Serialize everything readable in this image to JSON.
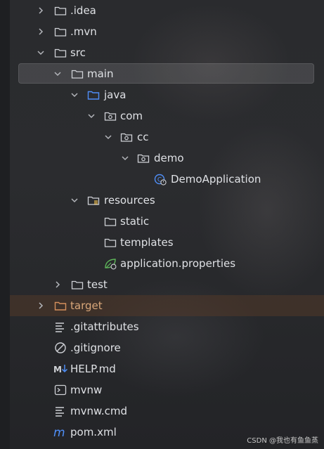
{
  "tree": {
    "items": [
      {
        "label": ".idea",
        "icon": "folder-icon"
      },
      {
        "label": ".mvn",
        "icon": "folder-icon"
      },
      {
        "label": "src",
        "icon": "folder-icon"
      },
      {
        "label": "main",
        "icon": "folder-icon"
      },
      {
        "label": "java",
        "icon": "source-folder-icon"
      },
      {
        "label": "com",
        "icon": "package-icon"
      },
      {
        "label": "cc",
        "icon": "package-icon"
      },
      {
        "label": "demo",
        "icon": "package-icon"
      },
      {
        "label": "DemoApplication",
        "icon": "spring-boot-class-icon"
      },
      {
        "label": "resources",
        "icon": "resources-folder-icon"
      },
      {
        "label": "static",
        "icon": "folder-icon"
      },
      {
        "label": "templates",
        "icon": "folder-icon"
      },
      {
        "label": "application.properties",
        "icon": "spring-properties-icon"
      },
      {
        "label": "test",
        "icon": "folder-icon"
      },
      {
        "label": "target",
        "icon": "excluded-folder-icon"
      },
      {
        "label": ".gitattributes",
        "icon": "text-file-icon"
      },
      {
        "label": ".gitignore",
        "icon": "ignore-file-icon"
      },
      {
        "label": "HELP.md",
        "icon": "markdown-icon"
      },
      {
        "label": "mvnw",
        "icon": "shell-script-icon"
      },
      {
        "label": "mvnw.cmd",
        "icon": "text-file-icon"
      },
      {
        "label": "pom.xml",
        "icon": "maven-icon"
      }
    ]
  },
  "watermark": "CSDN @我也有鱼鱼蒸",
  "colors": {
    "background": "#2b2c2f",
    "selection": "#3d3f43",
    "excluded_highlight": "#4a3a2e",
    "folder_outline": "#cfd1d6",
    "source_folder": "#4f8ef7",
    "excluded_folder": "#d58f5c",
    "spring_green": "#5fb85a",
    "maven_blue": "#4f8ef7"
  }
}
